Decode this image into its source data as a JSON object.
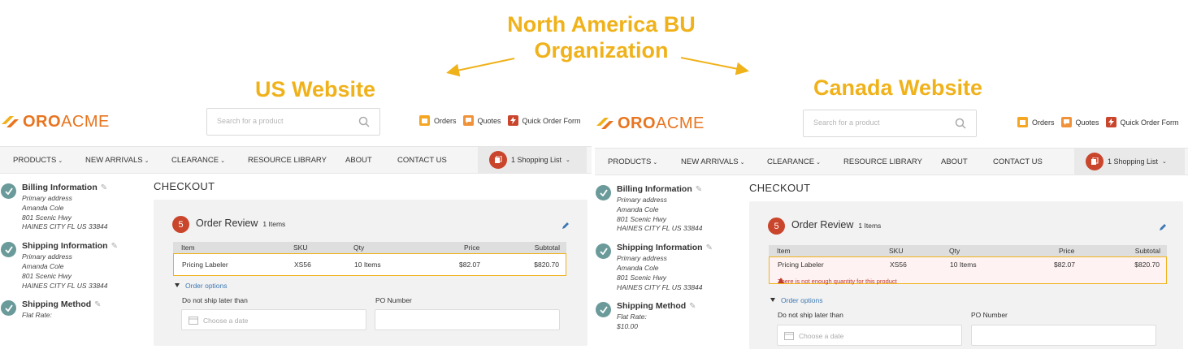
{
  "annotations": {
    "org": "North America BU Organization",
    "us": "US Website",
    "ca": "Canada Website"
  },
  "colors": {
    "accent": "#f0b21b",
    "brand": "#e8741e",
    "step": "#c9452b",
    "check": "#6b9a9a",
    "link": "#3c78b4"
  },
  "storefronts": [
    {
      "logo_bold": "ORO",
      "logo_rest": "ACME",
      "search_placeholder": "Search for a product",
      "tools": {
        "orders": "Orders",
        "quotes": "Quotes",
        "quick_order": "Quick Order Form"
      },
      "nav": [
        "PRODUCTS",
        "NEW ARRIVALS",
        "CLEARANCE",
        "RESOURCE LIBRARY",
        "ABOUT",
        "CONTACT US"
      ],
      "cart": "1 Shopping List",
      "steps": [
        {
          "title": "Billing Information",
          "lines": [
            "Primary address",
            "Amanda Cole",
            "801 Scenic Hwy",
            "HAINES CITY FL US 33844"
          ]
        },
        {
          "title": "Shipping Information",
          "lines": [
            "Primary address",
            "Amanda Cole",
            "801 Scenic Hwy",
            "HAINES CITY FL US 33844"
          ]
        },
        {
          "title": "Shipping Method",
          "lines": [
            "Flat Rate:"
          ]
        }
      ],
      "checkout_title": "CHECKOUT",
      "review": {
        "step_number": "5",
        "title": "Order Review",
        "count": "1 Items",
        "headers": {
          "item": "Item",
          "sku": "SKU",
          "qty": "Qty",
          "price": "Price",
          "subtotal": "Subtotal"
        },
        "row": {
          "item": "Pricing Labeler",
          "sku": "XS56",
          "qty": "10 Items",
          "price": "$82.07",
          "subtotal": "$820.70"
        },
        "warning": "",
        "order_options": "Order options",
        "ship_label": "Do not ship later than",
        "date_placeholder": "Choose a date",
        "po_label": "PO Number"
      }
    },
    {
      "logo_bold": "ORO",
      "logo_rest": "ACME",
      "search_placeholder": "Search for a product",
      "tools": {
        "orders": "Orders",
        "quotes": "Quotes",
        "quick_order": "Quick Order Form"
      },
      "nav": [
        "PRODUCTS",
        "NEW ARRIVALS",
        "CLEARANCE",
        "RESOURCE LIBRARY",
        "ABOUT",
        "CONTACT US"
      ],
      "cart": "1 Shopping List",
      "steps": [
        {
          "title": "Billing Information",
          "lines": [
            "Primary address",
            "Amanda Cole",
            "801 Scenic Hwy",
            "HAINES CITY FL US 33844"
          ]
        },
        {
          "title": "Shipping Information",
          "lines": [
            "Primary address",
            "Amanda Cole",
            "801 Scenic Hwy",
            "HAINES CITY FL US 33844"
          ]
        },
        {
          "title": "Shipping Method",
          "lines": [
            "Flat Rate:",
            "$10.00"
          ]
        }
      ],
      "checkout_title": "CHECKOUT",
      "review": {
        "step_number": "5",
        "title": "Order Review",
        "count": "1 Items",
        "headers": {
          "item": "Item",
          "sku": "SKU",
          "qty": "Qty",
          "price": "Price",
          "subtotal": "Subtotal"
        },
        "row": {
          "item": "Pricing Labeler",
          "sku": "XS56",
          "qty": "10 Items",
          "price": "$82.07",
          "subtotal": "$820.70"
        },
        "warning": "There is not enough quantity for this product",
        "order_options": "Order options",
        "ship_label": "Do not ship later than",
        "date_placeholder": "Choose a date",
        "po_label": "PO Number"
      }
    }
  ]
}
